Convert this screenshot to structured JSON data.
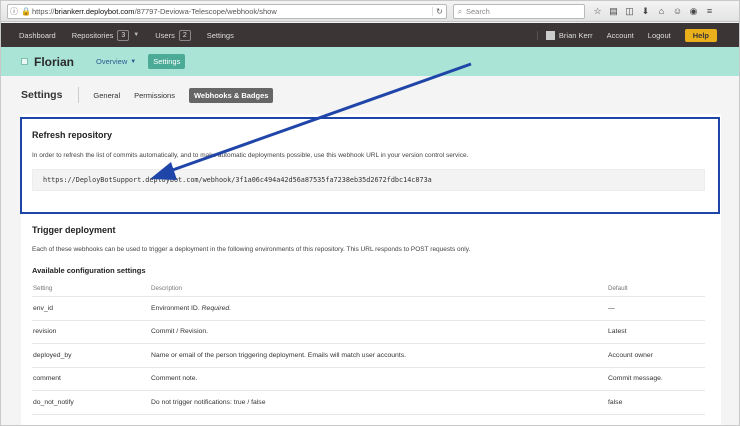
{
  "browser": {
    "url_prefix": "https://",
    "url_host": "briankerr.deploybot.com",
    "url_path": "/87797-Deviowa-Telescope/webhook/show",
    "search_placeholder": "Search"
  },
  "navbar": {
    "dashboard": "Dashboard",
    "repositories": "Repositories",
    "repositories_count": "3",
    "users": "Users",
    "users_count": "2",
    "settings": "Settings",
    "user_name": "Brian Kerr",
    "account": "Account",
    "logout": "Logout",
    "help": "Help"
  },
  "project": {
    "name": "Florian",
    "overview": "Overview",
    "settings_button": "Settings"
  },
  "subnav": {
    "title": "Settings",
    "tabs": [
      "General",
      "Permissions",
      "Webhooks & Badges"
    ],
    "active_tab": 2
  },
  "refresh": {
    "heading": "Refresh repository",
    "text": "In order to refresh the list of commits automatically, and to make automatic deployments possible, use this webhook URL in your version control service.",
    "url": "https://DeployBotSupport.deploybot.com/webhook/3f1a06c494a42d56a87535fa7238eb35d2672fdbc14c873a"
  },
  "trigger": {
    "heading": "Trigger deployment",
    "text": "Each of these webhooks can be used to trigger a deployment in the following environments of this repository. This URL responds to POST requests only.",
    "available_heading": "Available configuration settings",
    "columns": [
      "Setting",
      "Description",
      "Default"
    ],
    "rows": [
      {
        "setting": "env_id",
        "description": "Environment ID.",
        "description_em": "Required.",
        "default": "—"
      },
      {
        "setting": "revision",
        "description": "Commit / Revision.",
        "description_em": "",
        "default": "Latest"
      },
      {
        "setting": "deployed_by",
        "description": "Name or email of the person triggering deployment. Emails will match user accounts.",
        "description_em": "",
        "default": "Account owner"
      },
      {
        "setting": "comment",
        "description": "Comment note.",
        "description_em": "",
        "default": "Commit message."
      },
      {
        "setting": "do_not_notify",
        "description": "Do not trigger notifications: true / false",
        "description_em": "",
        "default": "false"
      }
    ]
  },
  "colors": {
    "highlight_border": "#1f45a8",
    "navbar_bg": "#3b3535",
    "project_bar_bg": "#a9e4d7",
    "accent_green": "#4bab97",
    "help_yellow": "#e9b01c"
  }
}
